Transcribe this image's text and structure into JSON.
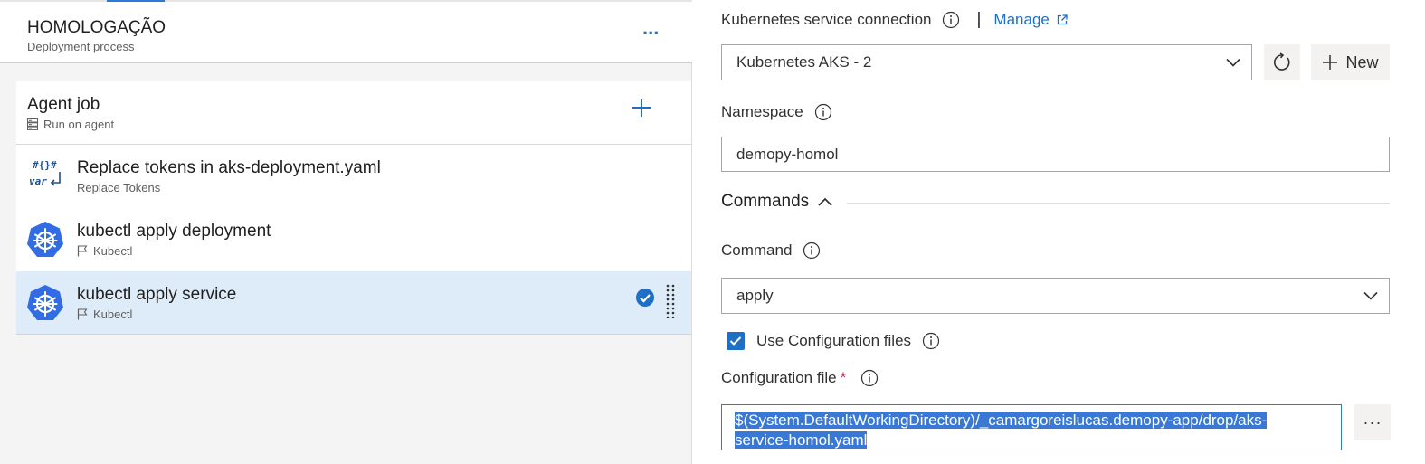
{
  "stage": {
    "title": "HOMOLOGAÇÃO",
    "subtitle": "Deployment process",
    "more_label": "..."
  },
  "agent_job": {
    "title": "Agent job",
    "subtitle": "Run on agent"
  },
  "tasks": [
    {
      "title": "Replace tokens in aks-deployment.yaml",
      "subtitle": "Replace Tokens",
      "icon": "replace-tokens-icon",
      "icon_text_top": "#{}#",
      "icon_text_bottom": "var",
      "selected": false
    },
    {
      "title": "kubectl apply deployment",
      "subtitle": "Kubectl",
      "icon": "kubernetes-icon",
      "selected": false
    },
    {
      "title": "kubectl apply service",
      "subtitle": "Kubectl",
      "icon": "kubernetes-icon",
      "selected": true
    }
  ],
  "form": {
    "k8s_connection": {
      "label": "Kubernetes service connection",
      "manage_label": "Manage",
      "value": "Kubernetes AKS - 2",
      "new_label": "New"
    },
    "namespace": {
      "label": "Namespace",
      "value": "demopy-homol"
    },
    "commands_section": {
      "label": "Commands"
    },
    "command": {
      "label": "Command",
      "value": "apply"
    },
    "use_config_files": {
      "label": "Use Configuration files",
      "checked": true
    },
    "config_file": {
      "label": "Configuration file",
      "required_mark": "*",
      "value_line1": "$(System.DefaultWorkingDirectory)/_camargoreislucas.demopy-app/drop/aks-",
      "value_line2": "service-homol.yaml",
      "browse_label": "···"
    }
  },
  "colors": {
    "accent": "#1f6fc5",
    "selected_row": "#deecf9",
    "kubernetes_blue": "#326ce5"
  }
}
